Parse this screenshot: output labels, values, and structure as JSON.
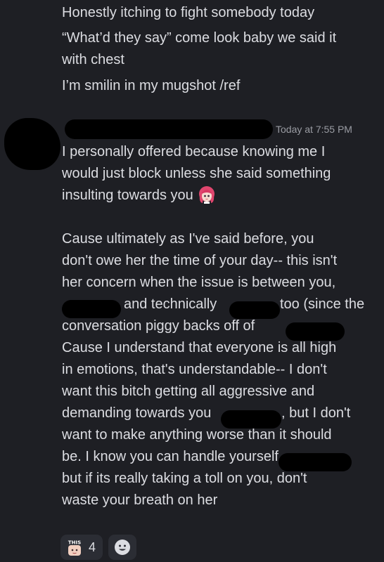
{
  "messages": {
    "first": {
      "lines": [
        "Honestly itching to fight somebody today",
        "“What’d they say” come look baby we said it",
        "with chest",
        "I’m smilin in my mugshot /ref"
      ]
    },
    "second": {
      "timestamp": "Today at 7:55 PM",
      "lines": [
        "I personally offered because knowing me I",
        "would just block unless she said something",
        "insulting towards you",
        "",
        "Cause ultimately as I've said before, you",
        "don't owe her the time of your day-- this isn't",
        "her concern when the issue is between you,",
        "and technically",
        "too (since the",
        "conversation piggy backs off of",
        "Cause I understand that everyone is all high",
        "in emotions, that's understandable-- I don't",
        "want this bitch getting all aggressive and",
        "demanding towards you",
        ", but I don't",
        "want to make anything worse than it should",
        "be. I know you can handle yourself",
        "but if its really taking a toll on you, don't",
        "waste your breath on her"
      ]
    }
  },
  "reactions": [
    {
      "icon": "this-sticker-icon",
      "label": "THIS",
      "count": "4"
    }
  ],
  "colors": {
    "background": "#1e1f24",
    "text": "#dcdde2",
    "timestamp": "#9a9ca3",
    "pill": "#2b2d34"
  }
}
